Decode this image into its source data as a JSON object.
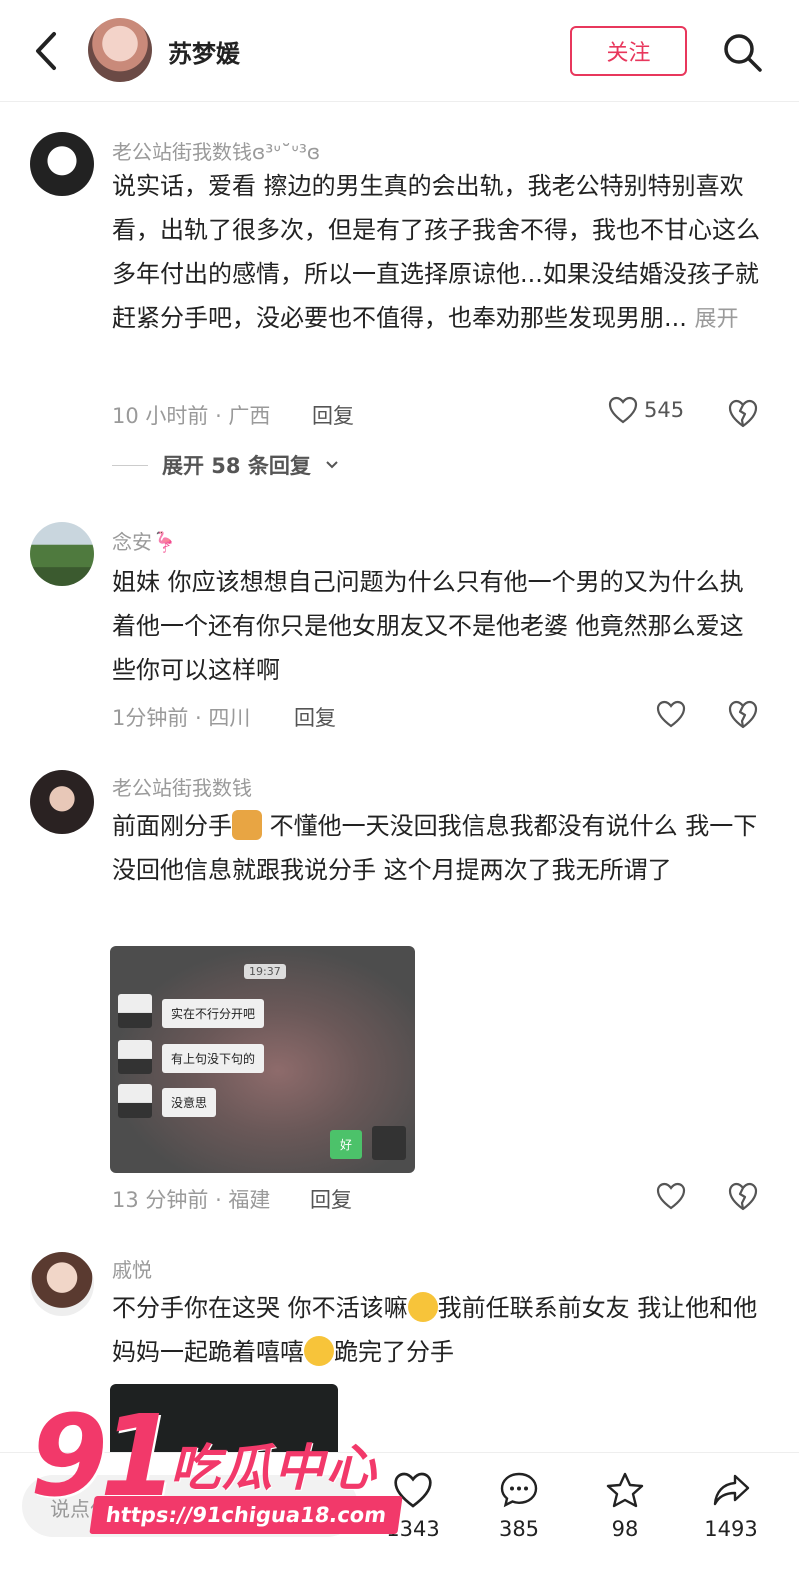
{
  "header": {
    "name": "苏梦媛",
    "follow_label": "关注"
  },
  "comments": [
    {
      "username": "老公站街我数钱ɞ³ᐡ˘ᐡ³ɞ",
      "text": "说实话，爱看 擦边的男生真的会出轨，我老公特别特别喜欢看，出轨了很多次，但是有了孩子我舍不得，我也不甘心这么多年付出的感情，所以一直选择原谅他...如果没结婚没孩子就赶紧分手吧，没必要也不值得，也奉劝那些发现男朋...",
      "expand_label": "展开",
      "meta": "10 小时前 · 广西",
      "reply_label": "回复",
      "likes": "545",
      "expand_replies": "展开 58 条回复"
    },
    {
      "username": "念安🦩",
      "text": "姐妹 你应该想想自己问题为什么只有他一个男的又为什么执着他一个还有你只是他女朋友又不是他老婆 他竟然那么爱这些你可以这样啊",
      "meta": "1分钟前 · 四川",
      "reply_label": "回复"
    },
    {
      "username": "老公站街我数钱",
      "text_before_emoji": "前面刚分手",
      "text_after_emoji": " 不懂他一天没回我信息我都没有说什么 我一下没回他信息就跟我说分手 这个月提两次了我无所谓了",
      "meta": "13 分钟前 · 福建",
      "reply_label": "回复",
      "chat": {
        "time": "19:37",
        "messages": [
          "实在不行分开吧",
          "有上句没下句的",
          "没意思"
        ],
        "my_message": "好"
      }
    },
    {
      "username": "戚悦",
      "text_part1": "不分手你在这哭 你不活该嘛",
      "text_part2": "我前任联系前女友 我让他和他妈妈一起跪着嘻嘻",
      "text_part3": "跪完了分手"
    }
  ],
  "bottom_bar": {
    "input_placeholder": "说点什么...",
    "likes": "1343",
    "comments": "385",
    "favorites": "98",
    "shares": "1493"
  },
  "watermark": {
    "number": "91",
    "brand": "吃瓜中心",
    "url": "https://91chigua18.com"
  },
  "colors": {
    "accent": "#e8375c",
    "watermark": "#f2396a",
    "meta_gray": "#9a9a9a"
  }
}
